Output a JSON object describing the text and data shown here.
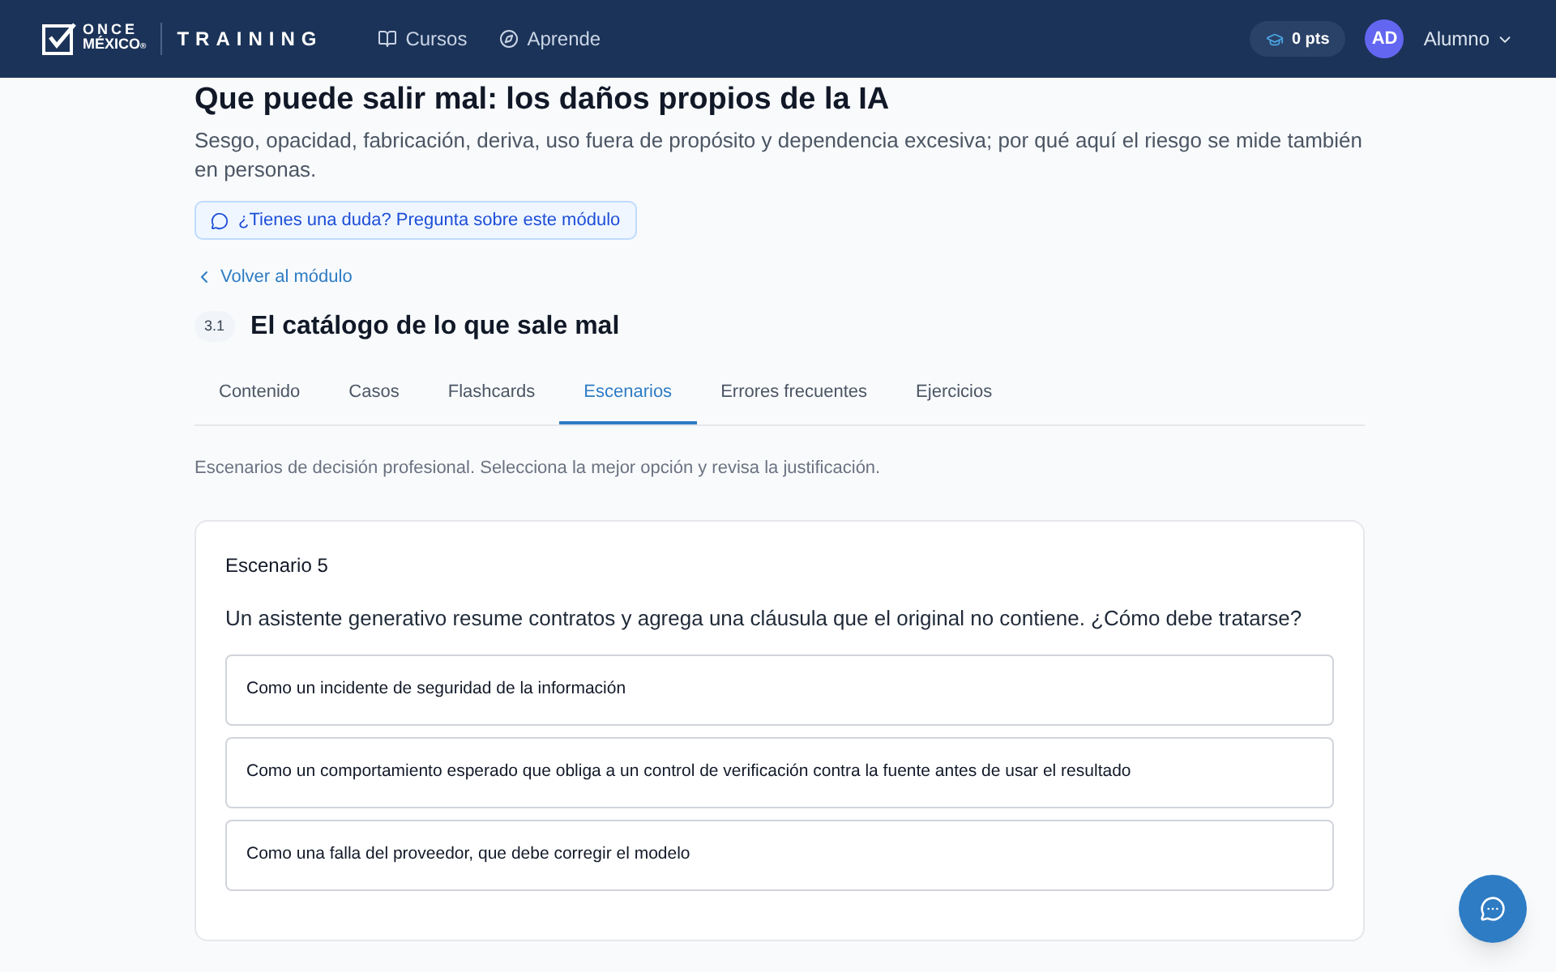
{
  "header": {
    "logo_top": "ONCE",
    "logo_bottom": "MÉXICO",
    "logo_mark": "®",
    "brand": "TRAINING",
    "nav": [
      {
        "label": "Cursos"
      },
      {
        "label": "Aprende"
      }
    ],
    "points": "0 pts",
    "avatar": "AD",
    "user": "Alumno"
  },
  "module": {
    "title": "Que puede salir mal: los daños propios de la IA",
    "description": "Sesgo, opacidad, fabricación, deriva, uso fuera de propósito y dependencia excesiva; por qué aquí el riesgo se mide también en personas.",
    "ask_button": "¿Tienes una duda? Pregunta sobre este módulo",
    "back_link": "Volver al módulo"
  },
  "lesson": {
    "number": "3.1",
    "title": "El catálogo de lo que sale mal"
  },
  "tabs": [
    {
      "label": "Contenido",
      "selected": false
    },
    {
      "label": "Casos",
      "selected": false
    },
    {
      "label": "Flashcards",
      "selected": false
    },
    {
      "label": "Escenarios",
      "selected": true
    },
    {
      "label": "Errores frecuentes",
      "selected": false
    },
    {
      "label": "Ejercicios",
      "selected": false
    }
  ],
  "intro": "Escenarios de decisión profesional. Selecciona la mejor opción y revisa la justificación.",
  "scenario": {
    "title": "Escenario 5",
    "question": "Un asistente generativo resume contratos y agrega una cláusula que el original no contiene. ¿Cómo debe tratarse?",
    "options": [
      {
        "label": "Como un incidente de seguridad de la información",
        "selected": false
      },
      {
        "label": "Como un comportamiento esperado que obliga a un control de verificación contra la fuente antes de usar el resultado",
        "selected": false
      },
      {
        "label": "Como una falla del proveedor, que debe corregir el modelo",
        "selected": false
      }
    ]
  }
}
